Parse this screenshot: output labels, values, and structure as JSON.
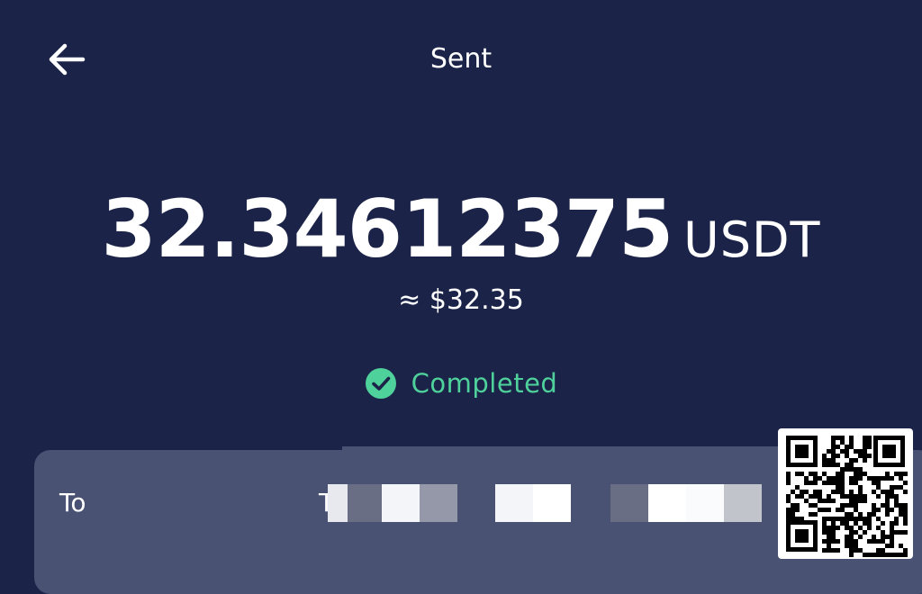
{
  "header": {
    "back_icon": "arrow-left-icon",
    "title": "Sent"
  },
  "transaction": {
    "amount": "32.34612375",
    "unit": "USDT",
    "fiat_equivalent": "≈ $32.35",
    "status": {
      "icon": "check-circle-icon",
      "label": "Completed",
      "color": "#4fd19b"
    }
  },
  "details": {
    "to_label": "To",
    "to_value_visible": "T"
  },
  "colors": {
    "background": "#1b2348",
    "card": "#4a5273",
    "success": "#4fd19b"
  }
}
